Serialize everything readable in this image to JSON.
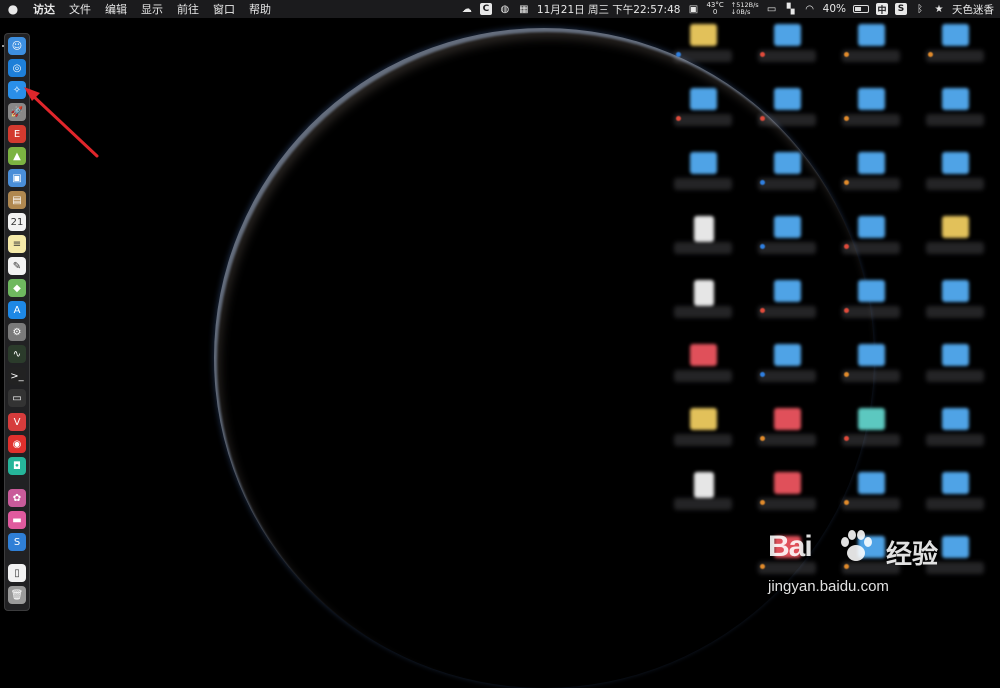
{
  "menubar": {
    "apple_icon": "apple-icon",
    "app_name": "访达",
    "menus": [
      "文件",
      "编辑",
      "显示",
      "前往",
      "窗口",
      "帮助"
    ],
    "status": {
      "temperature": "43°C",
      "temp_value": "0",
      "upload_speed": "↑512B/s",
      "download_speed": "↓0B/s",
      "datetime": "11月21日 周三 下午22:57:48",
      "battery": "40%",
      "input_method": "中",
      "user": "天色迷香"
    }
  },
  "dock": {
    "items": [
      {
        "name": "finder",
        "color": "#3d8fe0",
        "glyph": "☺"
      },
      {
        "name": "app-store-alt",
        "color": "#1e7fd8",
        "glyph": "◎"
      },
      {
        "name": "safari",
        "color": "#2a8fe8",
        "glyph": "✧"
      },
      {
        "name": "launchpad",
        "color": "#888888",
        "glyph": "🚀"
      },
      {
        "name": "app-red",
        "color": "#d33a2f",
        "glyph": "E"
      },
      {
        "name": "android",
        "color": "#7cb342",
        "glyph": "▲"
      },
      {
        "name": "preview",
        "color": "#4a8ed8",
        "glyph": "▣"
      },
      {
        "name": "notebook",
        "color": "#b08850",
        "glyph": "▤"
      },
      {
        "name": "calendar",
        "color": "#f2f2f2",
        "glyph": "21"
      },
      {
        "name": "notes",
        "color": "#f4e9a8",
        "glyph": "≡"
      },
      {
        "name": "textedit",
        "color": "#f2f2f2",
        "glyph": "✎"
      },
      {
        "name": "maps",
        "color": "#6fb85f",
        "glyph": "◆"
      },
      {
        "name": "app-store",
        "color": "#1e88e5",
        "glyph": "A"
      },
      {
        "name": "system-preferences",
        "color": "#7a7a7a",
        "glyph": "⚙"
      },
      {
        "name": "activity-monitor",
        "color": "#2b3b2b",
        "glyph": "∿"
      },
      {
        "name": "terminal",
        "color": "#222222",
        "glyph": ">_"
      },
      {
        "name": "blank-window",
        "color": "#333333",
        "glyph": "▭"
      },
      {
        "name": "vivaldi",
        "color": "#d63c3c",
        "glyph": "V"
      },
      {
        "name": "netease-music",
        "color": "#e0302d",
        "glyph": "◉"
      },
      {
        "name": "green-app",
        "color": "#26b59a",
        "glyph": "◘"
      },
      {
        "name": "photos",
        "color": "#c95b9a",
        "glyph": "✿"
      },
      {
        "name": "cleanmymac",
        "color": "#e05a9e",
        "glyph": "▬"
      },
      {
        "name": "scrivener",
        "color": "#2f7fd6",
        "glyph": "S"
      },
      {
        "name": "document",
        "color": "#f2f2f2",
        "glyph": "▯"
      },
      {
        "name": "trash",
        "color": "#9a9a9a",
        "glyph": "🗑"
      }
    ]
  },
  "desktop": {
    "colors": {
      "folder": "#4fa3e6",
      "folder_yellow": "#e2c15a",
      "folder_red": "#e0505a",
      "folder_teal": "#5cc8c0",
      "file": "#e6e6e6",
      "tag_blue": "#2f7fe0",
      "tag_red": "#e04b3b",
      "tag_orange": "#e08a2b"
    }
  },
  "watermark": {
    "logo": "Bai",
    "logo_cn": "经验",
    "url": "jingyan.baidu.com"
  }
}
